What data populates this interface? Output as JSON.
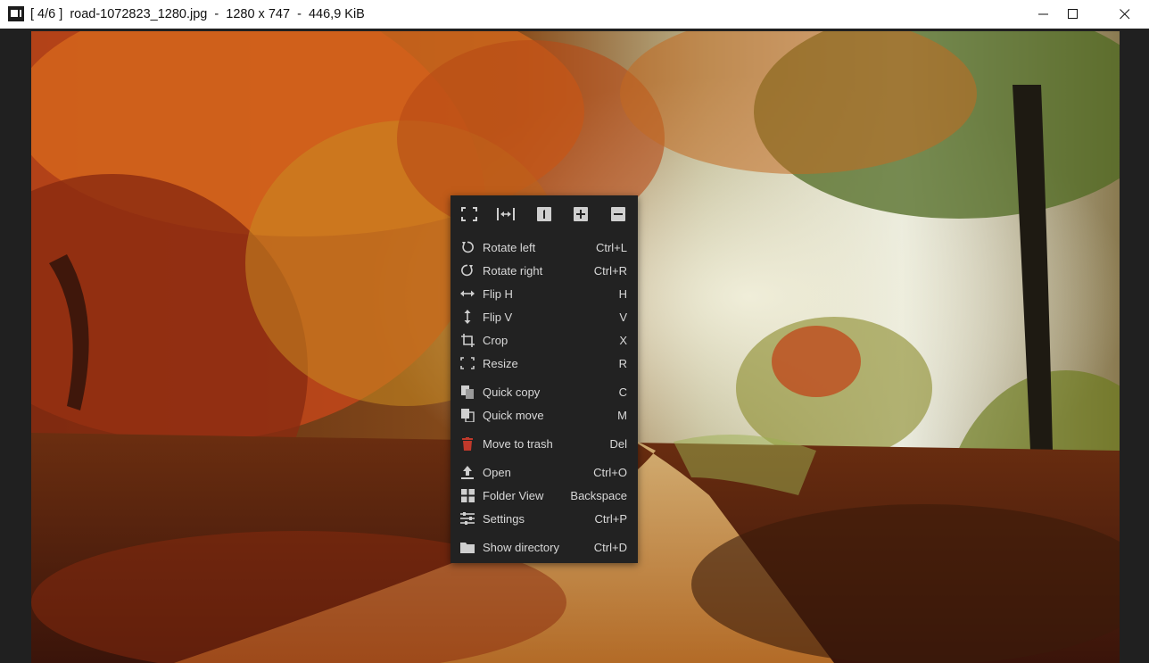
{
  "window": {
    "title": "[ 4/6 ]  road-1072823_1280.jpg  -  1280 x 747  -  446,9 KiB",
    "controls": [
      "minimize",
      "maximize",
      "close"
    ]
  },
  "image": {
    "subject": "autumn forest road"
  },
  "menu": {
    "toolbar": [
      {
        "name": "fit-window-icon"
      },
      {
        "name": "fit-width-icon"
      },
      {
        "name": "original-size-icon",
        "glyph": "1"
      },
      {
        "name": "zoom-in-icon"
      },
      {
        "name": "zoom-out-icon"
      }
    ],
    "items": [
      {
        "label": "Rotate left",
        "shortcut": "Ctrl+L",
        "icon": "rotate-left-icon"
      },
      {
        "label": "Rotate right",
        "shortcut": "Ctrl+R",
        "icon": "rotate-right-icon"
      },
      {
        "label": "Flip H",
        "shortcut": "H",
        "icon": "flip-h-icon"
      },
      {
        "label": "Flip V",
        "shortcut": "V",
        "icon": "flip-v-icon"
      },
      {
        "label": "Crop",
        "shortcut": "X",
        "icon": "crop-icon"
      },
      {
        "label": "Resize",
        "shortcut": "R",
        "icon": "resize-icon"
      },
      {
        "label": "Quick copy",
        "shortcut": "C",
        "icon": "copy-icon"
      },
      {
        "label": "Quick move",
        "shortcut": "M",
        "icon": "move-icon"
      },
      {
        "label": "Move to trash",
        "shortcut": "Del",
        "icon": "trash-icon",
        "icon_color": "#c0392b"
      },
      {
        "label": "Open",
        "shortcut": "Ctrl+O",
        "icon": "open-icon"
      },
      {
        "label": "Folder View",
        "shortcut": "Backspace",
        "icon": "folder-view-icon"
      },
      {
        "label": "Settings",
        "shortcut": "Ctrl+P",
        "icon": "settings-icon"
      },
      {
        "label": "Show directory",
        "shortcut": "Ctrl+D",
        "icon": "folder-icon"
      }
    ]
  }
}
